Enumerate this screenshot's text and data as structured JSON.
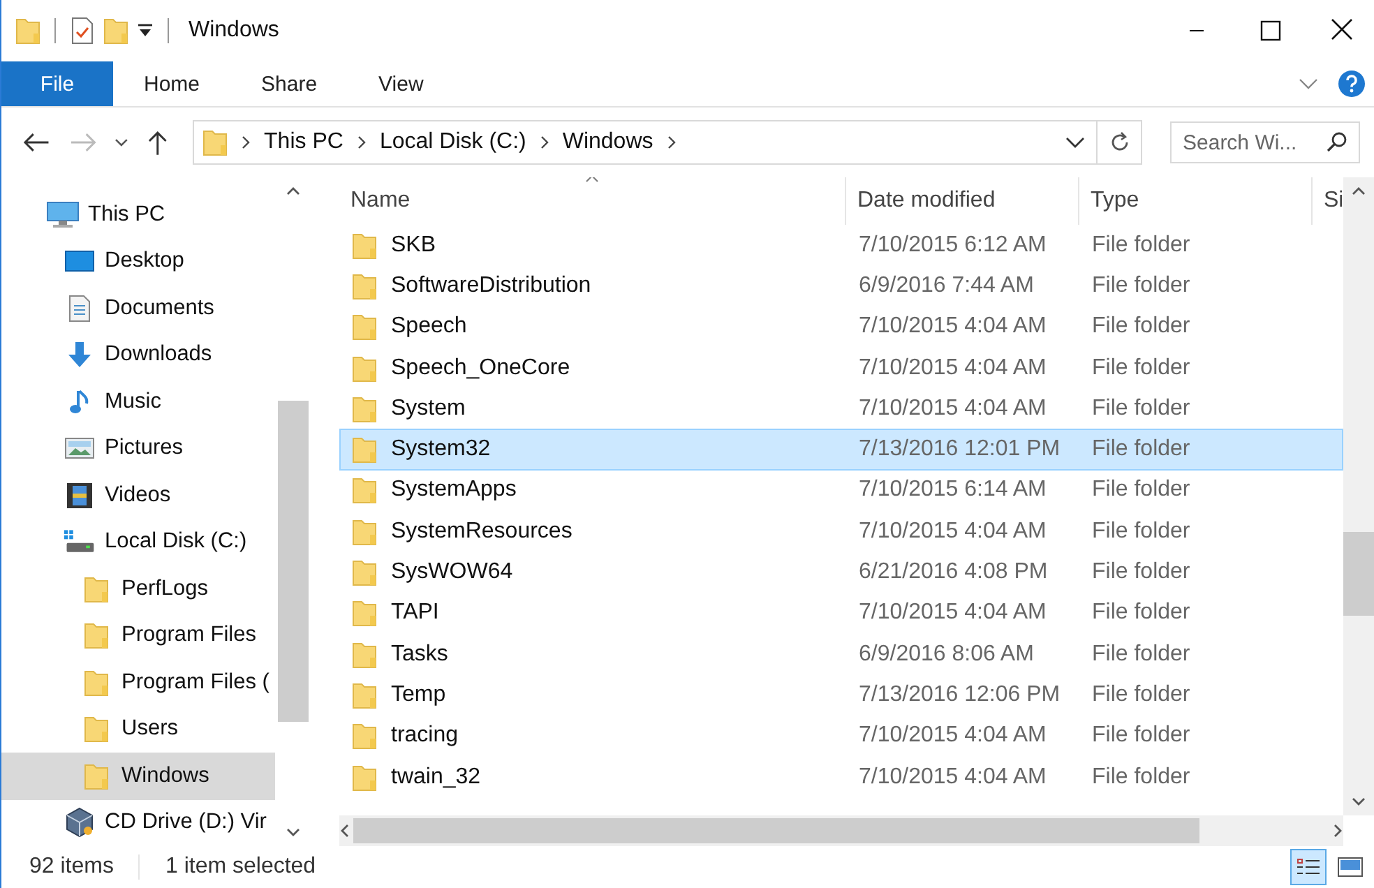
{
  "window": {
    "title": "Windows"
  },
  "ribbon": {
    "tabs": [
      {
        "label": "File",
        "kind": "file",
        "selected": false
      },
      {
        "label": "Home",
        "kind": "tab",
        "selected": false
      },
      {
        "label": "Share",
        "kind": "tab",
        "selected": false
      },
      {
        "label": "View",
        "kind": "tab",
        "selected": false
      }
    ]
  },
  "navigation": {
    "path": [
      "This PC",
      "Local Disk (C:)",
      "Windows"
    ],
    "search": {
      "placeholder": "Search Wi..."
    }
  },
  "sidebar": {
    "items": [
      {
        "label": "This PC",
        "kind": "pc",
        "selected": false,
        "children": [
          {
            "label": "Desktop",
            "kind": "desktop",
            "selected": false
          },
          {
            "label": "Documents",
            "kind": "documents",
            "selected": false
          },
          {
            "label": "Downloads",
            "kind": "downloads",
            "selected": false
          },
          {
            "label": "Music",
            "kind": "music",
            "selected": false
          },
          {
            "label": "Pictures",
            "kind": "pictures",
            "selected": false
          },
          {
            "label": "Videos",
            "kind": "videos",
            "selected": false
          },
          {
            "label": "Local Disk (C:)",
            "kind": "drive",
            "selected": false,
            "children": [
              {
                "label": "PerfLogs",
                "kind": "folder",
                "selected": false
              },
              {
                "label": "Program Files",
                "kind": "folder",
                "selected": false
              },
              {
                "label": "Program Files (",
                "kind": "folder",
                "selected": false
              },
              {
                "label": "Users",
                "kind": "folder",
                "selected": false
              },
              {
                "label": "Windows",
                "kind": "folder",
                "selected": true
              }
            ]
          },
          {
            "label": "CD Drive (D:) Vir",
            "kind": "cd",
            "selected": false
          }
        ]
      }
    ]
  },
  "file_list": {
    "columns": [
      {
        "label": "Name",
        "sort_ascending": true
      },
      {
        "label": "Date modified",
        "sort_ascending": false
      },
      {
        "label": "Type",
        "sort_ascending": false
      },
      {
        "label": "Si",
        "sort_ascending": false
      }
    ],
    "rows": [
      {
        "name": "SKB",
        "date": "7/10/2015 6:12 AM",
        "type": "File folder",
        "selected": false
      },
      {
        "name": "SoftwareDistribution",
        "date": "6/9/2016 7:44 AM",
        "type": "File folder",
        "selected": false
      },
      {
        "name": "Speech",
        "date": "7/10/2015 4:04 AM",
        "type": "File folder",
        "selected": false
      },
      {
        "name": "Speech_OneCore",
        "date": "7/10/2015 4:04 AM",
        "type": "File folder",
        "selected": false
      },
      {
        "name": "System",
        "date": "7/10/2015 4:04 AM",
        "type": "File folder",
        "selected": false
      },
      {
        "name": "System32",
        "date": "7/13/2016 12:01 PM",
        "type": "File folder",
        "selected": true
      },
      {
        "name": "SystemApps",
        "date": "7/10/2015 6:14 AM",
        "type": "File folder",
        "selected": false
      },
      {
        "name": "SystemResources",
        "date": "7/10/2015 4:04 AM",
        "type": "File folder",
        "selected": false
      },
      {
        "name": "SysWOW64",
        "date": "6/21/2016 4:08 PM",
        "type": "File folder",
        "selected": false
      },
      {
        "name": "TAPI",
        "date": "7/10/2015 4:04 AM",
        "type": "File folder",
        "selected": false
      },
      {
        "name": "Tasks",
        "date": "6/9/2016 8:06 AM",
        "type": "File folder",
        "selected": false
      },
      {
        "name": "Temp",
        "date": "7/13/2016 12:06 PM",
        "type": "File folder",
        "selected": false
      },
      {
        "name": "tracing",
        "date": "7/10/2015 4:04 AM",
        "type": "File folder",
        "selected": false
      },
      {
        "name": "twain_32",
        "date": "7/10/2015 4:04 AM",
        "type": "File folder",
        "selected": false
      }
    ]
  },
  "status_bar": {
    "item_count": "92 items",
    "selection": "1 item selected",
    "views": [
      {
        "kind": "details",
        "selected": true
      },
      {
        "kind": "large_icons",
        "selected": false
      }
    ]
  }
}
